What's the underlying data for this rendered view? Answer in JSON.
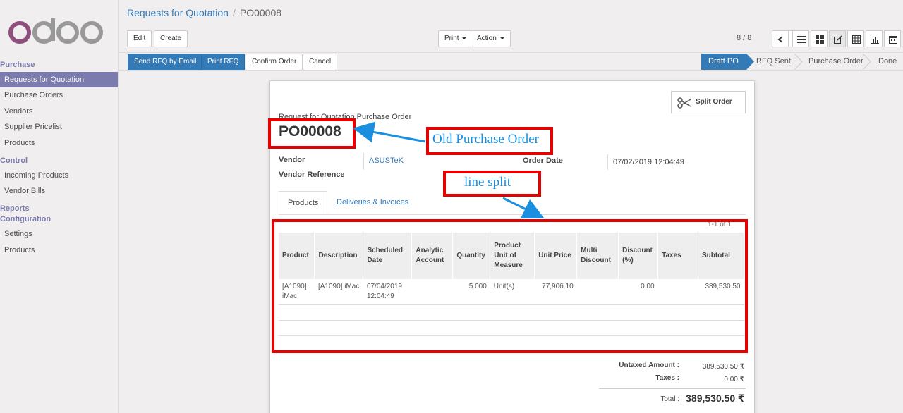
{
  "app": {
    "logo_text": "odoo"
  },
  "sidebar": {
    "sections": [
      {
        "label": "Purchase"
      },
      {
        "label": "Control"
      },
      {
        "label": "Reports"
      },
      {
        "label": "Configuration"
      }
    ],
    "items": [
      {
        "label": "Requests for Quotation",
        "active": true
      },
      {
        "label": "Purchase Orders"
      },
      {
        "label": "Vendors"
      },
      {
        "label": "Supplier Pricelist"
      },
      {
        "label": "Products"
      },
      {
        "label": "Incoming Products"
      },
      {
        "label": "Vendor Bills"
      },
      {
        "label": "Settings"
      },
      {
        "label": "Products"
      }
    ]
  },
  "breadcrumb": {
    "parent": "Requests for Quotation",
    "separator": "/",
    "current": "PO00008"
  },
  "toolbar": {
    "edit": "Edit",
    "create": "Create",
    "print": "Print",
    "action": "Action",
    "pager": "8 / 8"
  },
  "actions": {
    "send_email": "Send RFQ by Email",
    "print_rfq": "Print RFQ",
    "confirm": "Confirm Order",
    "cancel": "Cancel"
  },
  "statusbar": {
    "stages": [
      "Draft PO",
      "RFQ Sent",
      "Purchase Order",
      "Done"
    ],
    "active": "Draft PO"
  },
  "form": {
    "split_button": "Split Order",
    "doc_type": "Request for Quotation Purchase Order",
    "name": "PO00008",
    "vendor_label": "Vendor",
    "vendor_value": "ASUSTeK",
    "vendor_ref_label": "Vendor Reference",
    "order_date_label": "Order Date",
    "order_date_value": "07/02/2019 12:04:49",
    "tabs": [
      "Products",
      "Deliveries & Invoices"
    ],
    "counter": "1-1 of 1",
    "columns": [
      "Product",
      "Description",
      "Scheduled Date",
      "Analytic Account",
      "Quantity",
      "Product Unit of Measure",
      "Unit Price",
      "Multi Discount",
      "Discount (%)",
      "Taxes",
      "Subtotal"
    ],
    "line": {
      "product": "[A1090] iMac",
      "description": "[A1090] iMac",
      "scheduled_date": "07/04/2019 12:04:49",
      "analytic": "",
      "quantity": "5.000",
      "uom": "Unit(s)",
      "unit_price": "77,906.10",
      "multi_discount": "",
      "discount": "0.00",
      "taxes": "",
      "subtotal": "389,530.50"
    },
    "totals": {
      "untaxed_label": "Untaxed Amount :",
      "untaxed_value": "389,530.50 ₹",
      "taxes_label": "Taxes :",
      "taxes_value": "0.00 ₹",
      "total_label": "Total :",
      "total_value": "389,530.50 ₹"
    }
  },
  "annotations": {
    "old_order": "Old Purchase Order",
    "line_split": "line split",
    "color": "#e60000",
    "text_color": "#1a8fe0"
  }
}
